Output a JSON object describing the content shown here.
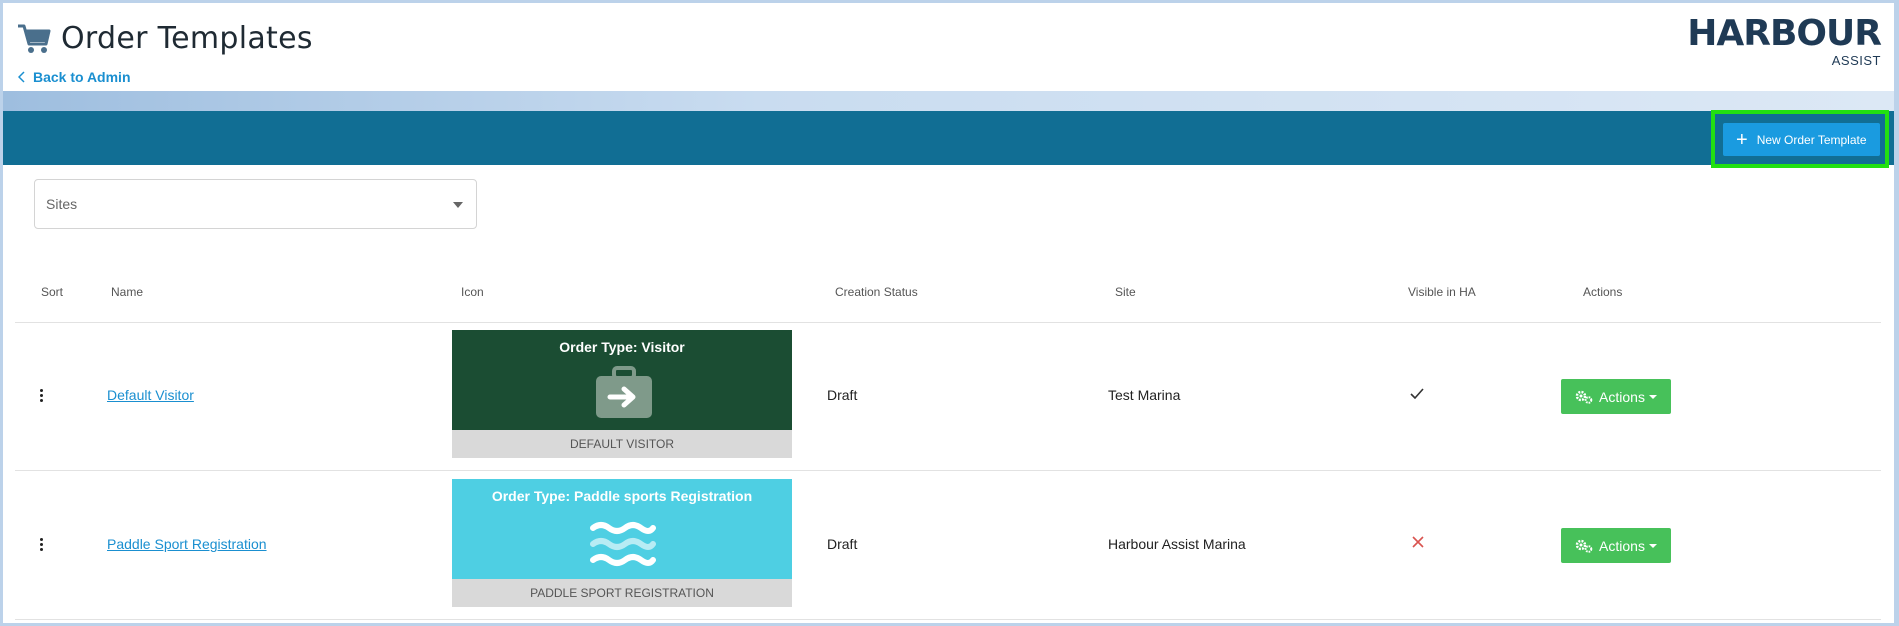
{
  "header": {
    "title": "Order Templates",
    "back_label": "Back to Admin",
    "logo_main": "HARBOUR",
    "logo_sub": "ASSIST"
  },
  "toolbar": {
    "new_template_label": "New Order Template"
  },
  "filter": {
    "sites_placeholder": "Sites"
  },
  "table": {
    "columns": [
      "Sort",
      "Name",
      "Icon",
      "Creation Status",
      "Site",
      "Visible in HA",
      "Actions"
    ],
    "rows": [
      {
        "name": "Default Visitor",
        "icon_title": "Order Type: Visitor",
        "icon_caption": "DEFAULT VISITOR",
        "icon_color": "#1b4d33",
        "icon": "briefcase-arrow-icon",
        "status": "Draft",
        "site": "Test Marina",
        "visible": true,
        "actions_label": "Actions"
      },
      {
        "name": "Paddle Sport Registration",
        "icon_title": "Order Type: Paddle sports Registration",
        "icon_caption": "PADDLE SPORT REGISTRATION",
        "icon_color": "#4ecfe3",
        "icon": "water-waves-icon",
        "status": "Draft",
        "site": "Harbour Assist Marina",
        "visible": false,
        "actions_label": "Actions"
      }
    ]
  },
  "colors": {
    "band": "#116e94",
    "primary_button": "#1a9be0",
    "success_button": "#47c15a",
    "link": "#1a8fd0",
    "highlight": "#22e011"
  }
}
